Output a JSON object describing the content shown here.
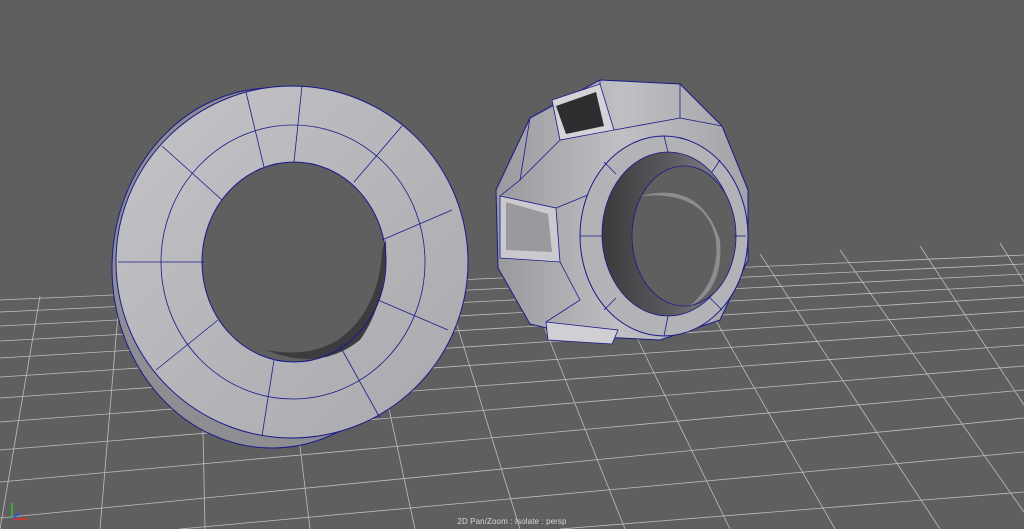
{
  "viewport": {
    "status_text": "2D Pan/Zoom : Isolate : persp",
    "background_color": "#5f5f5f",
    "grid_color": "#c8c8c8",
    "wire_color": "#1a1a8c",
    "mesh_color": "#b9b9bd",
    "axis_gizmo": {
      "x_color": "#e03030",
      "y_color": "#30c030",
      "z_color": "#3050e0"
    }
  }
}
